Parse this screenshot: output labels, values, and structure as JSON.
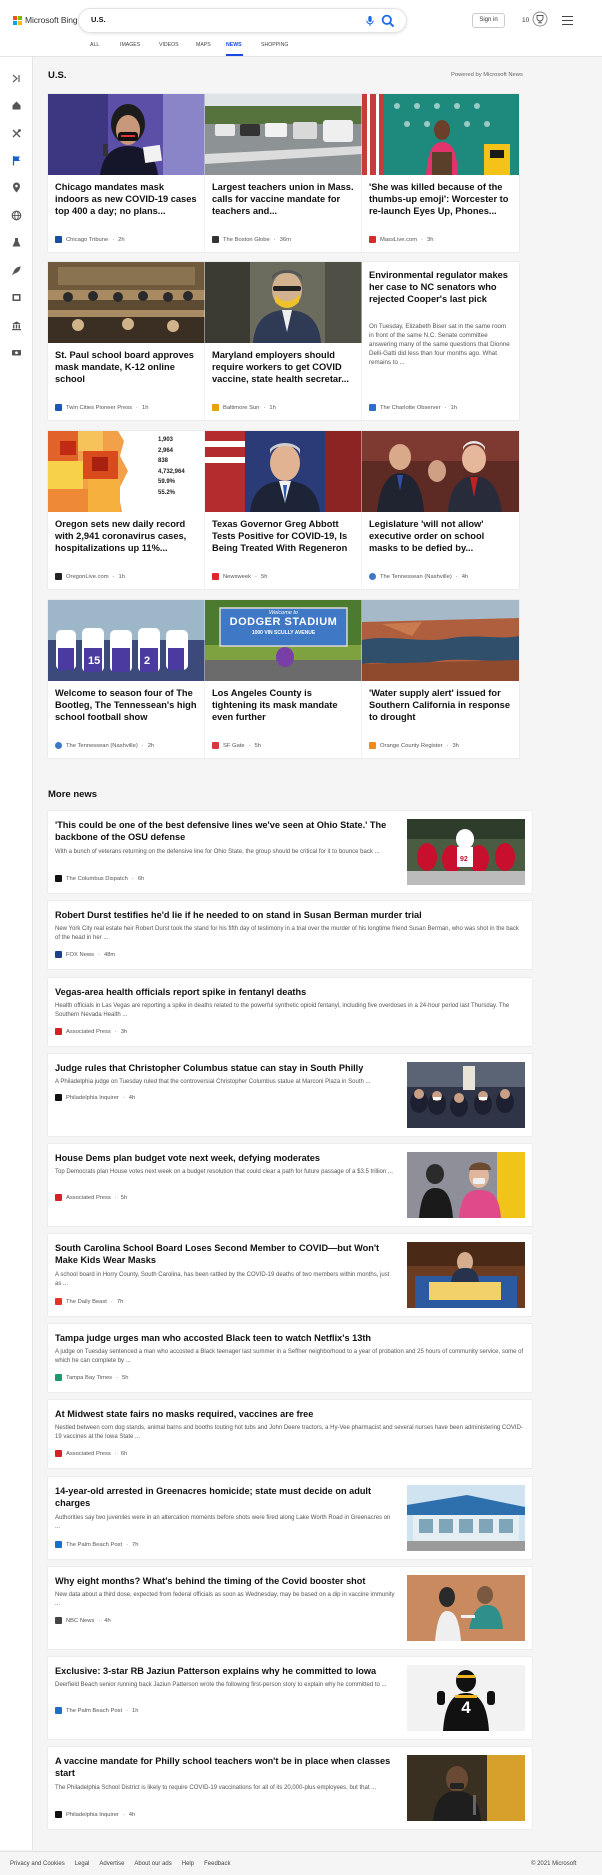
{
  "header": {
    "brand": "Microsoft Bing",
    "search_value": "U.S.",
    "sign_in": "Sign in",
    "rewards_count": "10",
    "nav": [
      {
        "label": "ALL",
        "active": false
      },
      {
        "label": "IMAGES",
        "active": false
      },
      {
        "label": "VIDEOS",
        "active": false
      },
      {
        "label": "MAPS",
        "active": false
      },
      {
        "label": "NEWS",
        "active": true
      },
      {
        "label": "SHOPPING",
        "active": false
      }
    ]
  },
  "sidebar": {
    "icons": [
      "menu-collapse-icon",
      "home-icon",
      "tools-icon",
      "flag-icon",
      "location-pin-icon",
      "globe-icon",
      "flask-icon",
      "rocket-icon",
      "film-icon",
      "bank-icon",
      "money-icon"
    ]
  },
  "section": {
    "title": "U.S.",
    "powered_by": "Powered by Microsoft News"
  },
  "cards": [
    {
      "title": "Chicago mandates mask indoors as new COVID-19 cases top 400 a day; no plans...",
      "source": "Chicago Tribune",
      "time": "2h",
      "logo_color": "#1a4fa0",
      "image": "mask-woman"
    },
    {
      "title": "Largest teachers union in Mass. calls for vaccine mandate for teachers and...",
      "source": "The Boston Globe",
      "time": "36m",
      "logo_color": "#333333",
      "image": "parking-lot"
    },
    {
      "title": "'She was killed because of the thumbs-up emoji': Worcester to re-launch Eyes Up, Phones...",
      "source": "MassLive.com",
      "time": "3h",
      "logo_color": "#d0302b",
      "image": "press-conference"
    },
    {
      "title": "St. Paul school board approves mask mandate, K-12 online school",
      "source": "Twin Cities Pioneer Press",
      "time": "1h",
      "logo_color": "#1b57b4",
      "image": "board-meeting"
    },
    {
      "title": "Maryland employers should require workers to get COVID vaccine, state health secretar...",
      "source": "Baltimore Sun",
      "time": "1h",
      "logo_color": "#e8a20c",
      "image": "masked-man"
    },
    {
      "title": "Environmental regulator makes her case to NC senators who rejected Cooper's last pick",
      "snippet": "On Tuesday, Elizabeth Biser sat in the same room in front of the same N.C. Senate committee answering many of the same questions that Dionne Delli-Gatti did less than four months ago. What remains to ...",
      "source": "The Charlotte Observer",
      "time": "1h",
      "logo_color": "#2d6dcc",
      "image": ""
    },
    {
      "title": "Oregon sets new daily record with 2,941 coronavirus cases, hospitalizations up 11%...",
      "source": "OregonLive.com",
      "time": "1h",
      "logo_color": "#222222",
      "image": "oregon-map",
      "map_numbers": [
        "1,903",
        "2,964",
        "838",
        "4,732,964",
        "59.9%",
        "55.2%"
      ]
    },
    {
      "title": "Texas Governor Greg Abbott Tests Positive for COVID-19, Is Being Treated With Regeneron",
      "source": "Newsweek",
      "time": "5h",
      "logo_color": "#e0262a",
      "image": "governor"
    },
    {
      "title": "Legislature 'will not allow' executive order on school masks to be defied by...",
      "source": "The Tennessean (Nashville)",
      "time": "4h",
      "logo_color": "#3b77c7",
      "image": "legislators"
    },
    {
      "title": "Welcome to season four of The Bootleg, The Tennessean's high school football show",
      "source": "The Tennessean (Nashville)",
      "time": "2h",
      "logo_color": "#3b77c7",
      "image": "football-team"
    },
    {
      "title": "Los Angeles County is tightening its mask mandate even further",
      "source": "SF Gate",
      "time": "5h",
      "logo_color": "#d9363e",
      "image": "dodger-stadium",
      "sign_text": "DODGER STADIUM",
      "sign_sub": "1000 VIN SCULLY AVENUE",
      "sign_top": "Welcome to"
    },
    {
      "title": "'Water supply alert' issued for Southern California in response to drought",
      "source": "Orange County Register",
      "time": "3h",
      "logo_color": "#f08a1c",
      "image": "lake"
    }
  ],
  "more_news_title": "More news",
  "more_news": [
    {
      "title": "'This could be one of the best defensive lines we've seen at Ohio State.' The backbone of the OSU defense",
      "snippet": "With a bunch of veterans returning on the defensive line for Ohio State, the group should be critical for it to bounce back ...",
      "source": "The Columbus Dispatch",
      "time": "6h",
      "logo_color": "#111111",
      "image": "football-line"
    },
    {
      "title": "Robert Durst testifies he'd lie if he needed to on stand in Susan Berman murder trial",
      "snippet": "New York City real estate heir Robert Durst took the stand for his fifth day of testimony in a trial over the murder of his longtime friend Susan Berman, who was shot in the back of the head in her ...",
      "source": "FOX News",
      "time": "48m",
      "logo_color": "#1d3f8f",
      "image": ""
    },
    {
      "title": "Vegas-area health officials report spike in fentanyl deaths",
      "snippet": "Health officials in Las Vegas are reporting a spike in deaths related to the powerful synthetic opioid fentanyl, including five overdoses in a 24-hour period last Thursday. The Southern Nevada Health ...",
      "source": "Associated Press",
      "time": "3h",
      "logo_color": "#d6202a",
      "image": ""
    },
    {
      "title": "Judge rules that Christopher Columbus statue can stay in South Philly",
      "snippet": "A Philadelphia judge on Tuesday ruled that the controversial Christopher Columbus statue at Marconi Plaza in South ...",
      "source": "Philadelphia Inquirer",
      "time": "4h",
      "logo_color": "#111111",
      "image": "statue-crowd"
    },
    {
      "title": "House Dems plan budget vote next week, defying moderates",
      "snippet": "Top Democrats plan House votes next week on a budget resolution that could clear a path for future passage of a $3.5 trillion ...",
      "source": "Associated Press",
      "time": "5h",
      "logo_color": "#d6202a",
      "image": "pelosi"
    },
    {
      "title": "South Carolina School Board Loses Second Member to COVID—but Won't Make Kids Wear Masks",
      "snippet": "A school board in Horry County, South Carolina, has been rattled by the COVID-19 deaths of two members within months, just as ...",
      "source": "The Daily Beast",
      "time": "7h",
      "logo_color": "#e5332a",
      "image": "school-board"
    },
    {
      "title": "Tampa judge urges man who accosted Black teen to watch Netflix's 13th",
      "snippet": "A judge on Tuesday sentenced a man who accosted a Black teenager last summer in a Seffner neighborhood to a year of probation and 25 hours of community service, some of which he can complete by ...",
      "source": "Tampa Bay Times",
      "time": "5h",
      "logo_color": "#1a9a6b",
      "image": ""
    },
    {
      "title": "At Midwest state fairs no masks required, vaccines are free",
      "snippet": "Nestled between corn dog stands, animal barns and booths touting hot tubs and John Deere tractors, a Hy-Vee pharmacist and several nurses have been administering COVID-19 vaccines at the Iowa State ...",
      "source": "Associated Press",
      "time": "6h",
      "logo_color": "#d6202a",
      "image": ""
    },
    {
      "title": "14-year-old arrested in Greenacres homicide; state must decide on adult charges",
      "snippet": "Authorities say two juveniles were in an altercation moments before shots were fired along Lake Worth Road in Greenacres on ...",
      "source": "The Palm Beach Post",
      "time": "7h",
      "logo_color": "#1c6fc6",
      "image": "building"
    },
    {
      "title": "Why eight months? What's behind the timing of the Covid booster shot",
      "snippet": "New data about a third dose, expected from federal officials as soon as Wednesday, may be based on a dip in vaccine immunity ...",
      "source": "NBC News",
      "time": "4h",
      "logo_color": "#444444",
      "image": "vaccination"
    },
    {
      "title": "Exclusive: 3-star RB Jaziun Patterson explains why he committed to Iowa",
      "snippet": "Deerfield Beach senior running back Jaziun Patterson wrote the following first-person story to explain why he committed to ...",
      "source": "The Palm Beach Post",
      "time": "1h",
      "logo_color": "#1c6fc6",
      "image": "iowa-player",
      "jersey": "4"
    },
    {
      "title": "A vaccine mandate for Philly school teachers won't be in place when classes start",
      "snippet": "The Philadelphia School District is likely to require COVID-19 vaccinations for all of its 20,000-plus employees, but that ...",
      "source": "Philadelphia Inquirer",
      "time": "4h",
      "logo_color": "#111111",
      "image": "philly-official"
    }
  ],
  "footer": {
    "links": [
      "Privacy and Cookies",
      "Legal",
      "Advertise",
      "About our ads",
      "Help",
      "Feedback"
    ],
    "copyright": "© 2021 Microsoft"
  }
}
